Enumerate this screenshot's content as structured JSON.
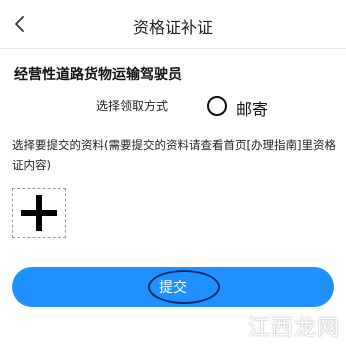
{
  "header": {
    "title": "资格证补证",
    "back_icon": "chevron-left-icon"
  },
  "form": {
    "section_title": "经营性道路货物运输驾驶员",
    "method_label": "选择领取方式",
    "method_option": "邮寄",
    "upload_instructions": "选择要提交的资料(需要提交的资料请查看首页[办理指南]里资格证内容)",
    "add_icon": "plus-icon"
  },
  "actions": {
    "submit_label": "提交",
    "accent_color": "#1e90ff",
    "annotation_color": "#0b2a66"
  },
  "watermark": {
    "text": "江西龙网"
  }
}
